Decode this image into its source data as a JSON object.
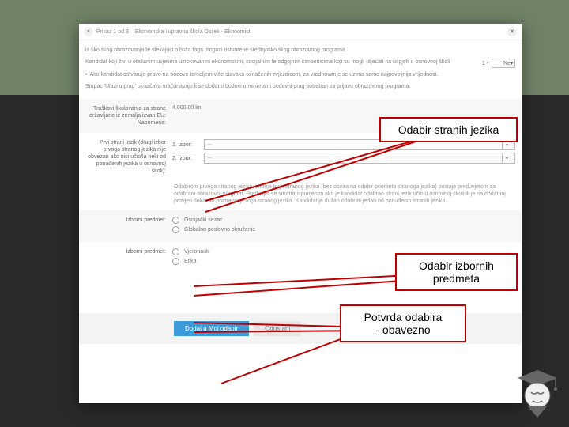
{
  "header": {
    "step_badge": "<",
    "step_text": "Prikaz 1 od 3",
    "school_name": "Ekonomska i upravna škola Osijek - Ekonomist"
  },
  "intro": {
    "p1": "iz školskog obrazovanja te stekajući o bliža toga mogući ostvarene srednjoškolskog obrazovnog programa",
    "p2": "Kandidat koji živi u otežanim uvjetima uzrokovanim ekonomskim, socijalnim te odgojnim čimbenicima koji su mogli utjecati na uspjeh u osnovnoj školi",
    "bullet1": "Ako kandidat ostvaruje pravo na bodove temeljem više stavaka označenih zvjezdicom, za vrednovanje se uzima samo najpovoljnija vrijednost.",
    "stupac": "Stupac 'Ulazi u prag' označava uračunavaju li se dodatni bodovi u minimalni bodovni prag potreban za prijavu obrazovnog programa.",
    "sel_label": "1 -",
    "sel_value": "Ne"
  },
  "cost": {
    "label": "Troškovi školovanja za strane državljane iz zemalja izvan EU:",
    "value": "4.000,00 kn",
    "note_label": "Napomena:"
  },
  "lang": {
    "label": "Prvi strani jezik (drugi izbor prvoga stranog jezika nije obvezan ako nisi učio/la neki od ponuđenih jezika u osnovnoj školi):",
    "row1": "1. izbor:",
    "row2": "2. izbor:",
    "placeholder": "--",
    "note": "Odabirom prvoga stranog jezika, znanje toga stranog jezika (bez obzira na odabir prioriteta stranoga jezika) postaje preduvjetom za odabrani obrazovni program. Preduvjet se smatra ispunjenim ako je kandidat odabrao strani jezik učio u osnovnoj školi ili je na dodatnoj provjeri dokazao poznavanje toga stranog jezika. Kandidat je dužan odabrati jedan od ponuđenih stranih jezika."
  },
  "elective1": {
    "label": "Izborni predmet:",
    "opt1": "Osnijački sezac",
    "opt2": "Globalno poslovno okruženje"
  },
  "elective2": {
    "label": "Izborni predmet:",
    "opt1": "Vjeronauk",
    "opt2": "Etika"
  },
  "actions": {
    "primary": "Dodaj u Moj odabir",
    "secondary": "Odustani"
  },
  "callouts": {
    "c1": "Odabir stranih jezika",
    "c2": "Odabir izbornih predmeta",
    "c3_l1": "Potvrda odabira",
    "c3_l2": "- obavezno"
  }
}
